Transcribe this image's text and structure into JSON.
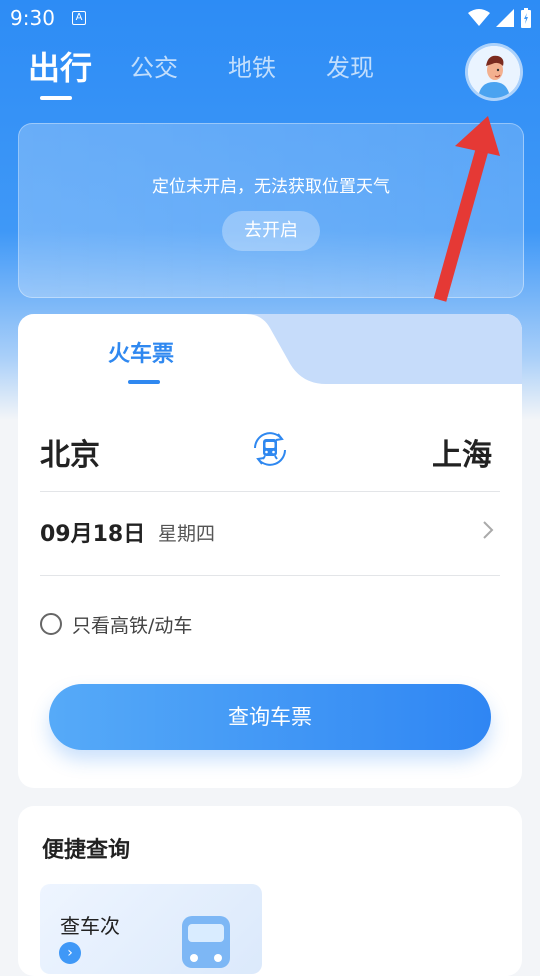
{
  "status_bar": {
    "time": "9:30",
    "a_icon": "A"
  },
  "tabs": [
    {
      "label": "出行",
      "active": true
    },
    {
      "label": "公交",
      "active": false
    },
    {
      "label": "地铁",
      "active": false
    },
    {
      "label": "发现",
      "active": false
    }
  ],
  "weather": {
    "message": "定位未开启，无法获取位置天气",
    "enable_button": "去开启"
  },
  "ticket": {
    "tab_label": "火车票",
    "from_city": "北京",
    "to_city": "上海",
    "date": "09月18日",
    "weekday": "星期四",
    "high_speed_only_label": "只看高铁/动车",
    "query_button": "查询车票"
  },
  "quick_query": {
    "title": "便捷查询",
    "item_label": "查车次"
  },
  "colors": {
    "accent": "#2f88f0",
    "arrow": "#e53935"
  }
}
